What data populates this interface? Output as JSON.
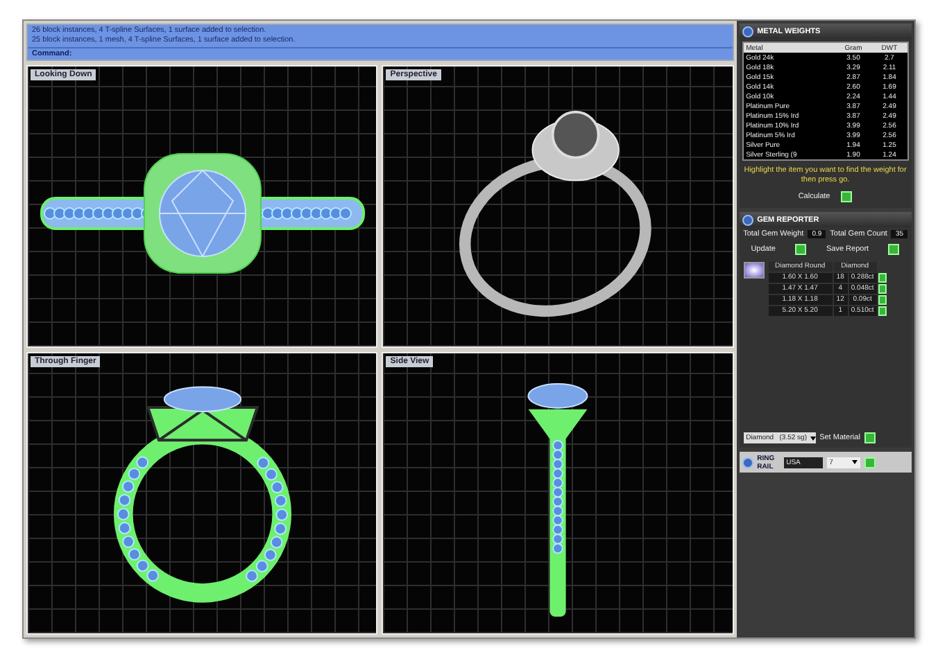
{
  "command_history": [
    "26 block instances, 4 T-spline Surfaces, 1 surface added to selection.",
    "25 block instances, 1 mesh, 4 T-spline Surfaces, 1 surface added to selection."
  ],
  "command_prompt": "Command:",
  "viewports": [
    {
      "title": "Looking Down",
      "kind": "top"
    },
    {
      "title": "Perspective",
      "kind": "perspective"
    },
    {
      "title": "Through Finger",
      "kind": "front"
    },
    {
      "title": "Side View",
      "kind": "side"
    }
  ],
  "metal_weights": {
    "title": "METAL WEIGHTS",
    "columns": [
      "Metal",
      "Gram",
      "DWT"
    ],
    "rows": [
      [
        "Gold 24k",
        "3.50",
        "2.7"
      ],
      [
        "Gold 18k",
        "3.29",
        "2.11"
      ],
      [
        "Gold 15k",
        "2.87",
        "1.84"
      ],
      [
        "Gold 14k",
        "2.60",
        "1.69"
      ],
      [
        "Gold 10k",
        "2.24",
        "1.44"
      ],
      [
        "Platinum Pure",
        "3.87",
        "2.49"
      ],
      [
        "Platinum 15% Ird",
        "3.87",
        "2.49"
      ],
      [
        "Platinum 10% Ird",
        "3.99",
        "2.56"
      ],
      [
        "Platinum 5% Ird",
        "3.99",
        "2.56"
      ],
      [
        "Silver Pure",
        "1.94",
        "1.25"
      ],
      [
        "Silver Sterling (9",
        "1.90",
        "1.24"
      ]
    ],
    "hint": "Highlight the item you want to find the weight for then press go.",
    "calculate_label": "Calculate"
  },
  "gem_reporter": {
    "title": "GEM REPORTER",
    "weight_label": "Total Gem Weight",
    "weight": "0.9",
    "count_label": "Total Gem Count",
    "count": "35",
    "update_label": "Update",
    "save_label": "Save Report",
    "columns": [
      "Diamond Round",
      "Diamond"
    ],
    "rows": [
      [
        "1.60 X 1.60",
        "18",
        "0.288ct"
      ],
      [
        "1.47 X 1.47",
        "4",
        "0.048ct"
      ],
      [
        "1.18 X 1.18",
        "12",
        "0.09ct"
      ],
      [
        "5.20 X 5.20",
        "1",
        "0.510ct"
      ]
    ]
  },
  "material": {
    "value": "Diamond   (3.52 sg)",
    "button": "Set Material"
  },
  "ring_rail": {
    "title": "RING RAIL",
    "country": "USA",
    "size": "7"
  }
}
